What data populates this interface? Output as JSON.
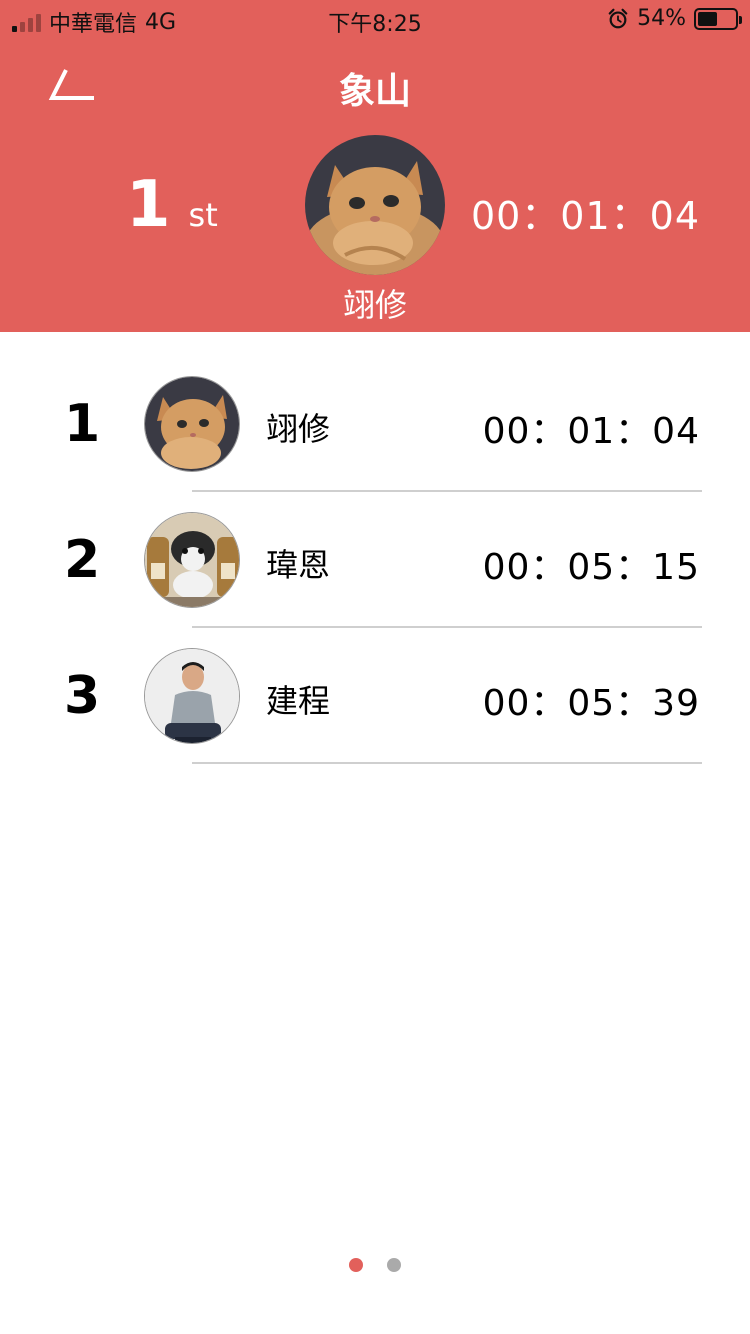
{
  "status_bar": {
    "carrier": "中華電信",
    "network": "4G",
    "time": "下午8:25",
    "battery_percent": "54%",
    "battery_level": 0.54,
    "signal_icon": "cellular-signal-icon",
    "alarm_icon": "alarm-clock-icon",
    "battery_icon": "battery-icon"
  },
  "header": {
    "title": "象山",
    "back_icon": "back-arrow-icon",
    "background_color": "#e2605b",
    "top_rank": "1",
    "top_rank_suffix": "st",
    "top_name": "翊修",
    "top_time": "00：01：04"
  },
  "leaderboard": [
    {
      "rank": "1",
      "name": "翊修",
      "time": "00：01：04",
      "avatar": "cat-avatar"
    },
    {
      "rank": "2",
      "name": "瑋恩",
      "time": "00：05：15",
      "avatar": "dog-avatar"
    },
    {
      "rank": "3",
      "name": "建程",
      "time": "00：05：39",
      "avatar": "person-avatar"
    }
  ],
  "pagination": {
    "pages": 2,
    "current": 1,
    "active_color": "#e2605b",
    "inactive_color": "#aaaaaa"
  }
}
